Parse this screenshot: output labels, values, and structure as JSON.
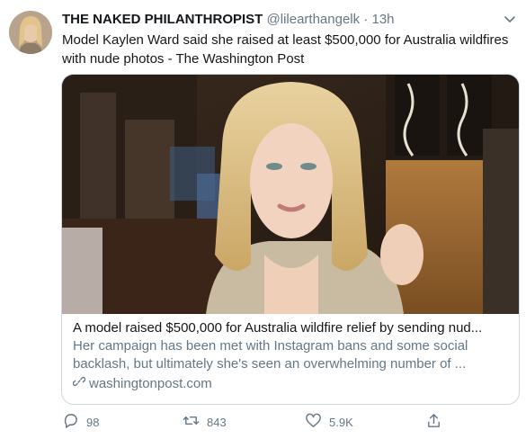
{
  "tweet": {
    "author_name": "THE NAKED PHILANTHROPIST",
    "handle": "@lilearthangelk",
    "separator": "·",
    "time": "13h",
    "text": "Model Kaylen Ward said she raised at least $500,000 for Australia wildfires with nude photos - The Washington Post"
  },
  "card": {
    "title": "A model raised $500,000 for Australia wildfire relief by sending nud...",
    "description": "Her campaign has been met with Instagram bans and some social backlash, but ultimately she's seen an overwhelming number of ...",
    "domain": "washingtonpost.com"
  },
  "actions": {
    "reply_count": "98",
    "retweet_count": "843",
    "like_count": "5.9K"
  },
  "icons": [
    "chevron-down-icon",
    "link-icon",
    "reply-icon",
    "retweet-icon",
    "like-icon",
    "share-icon"
  ],
  "colors": {
    "text": "#14171a",
    "secondary": "#657786",
    "border": "#ccd6dd"
  }
}
